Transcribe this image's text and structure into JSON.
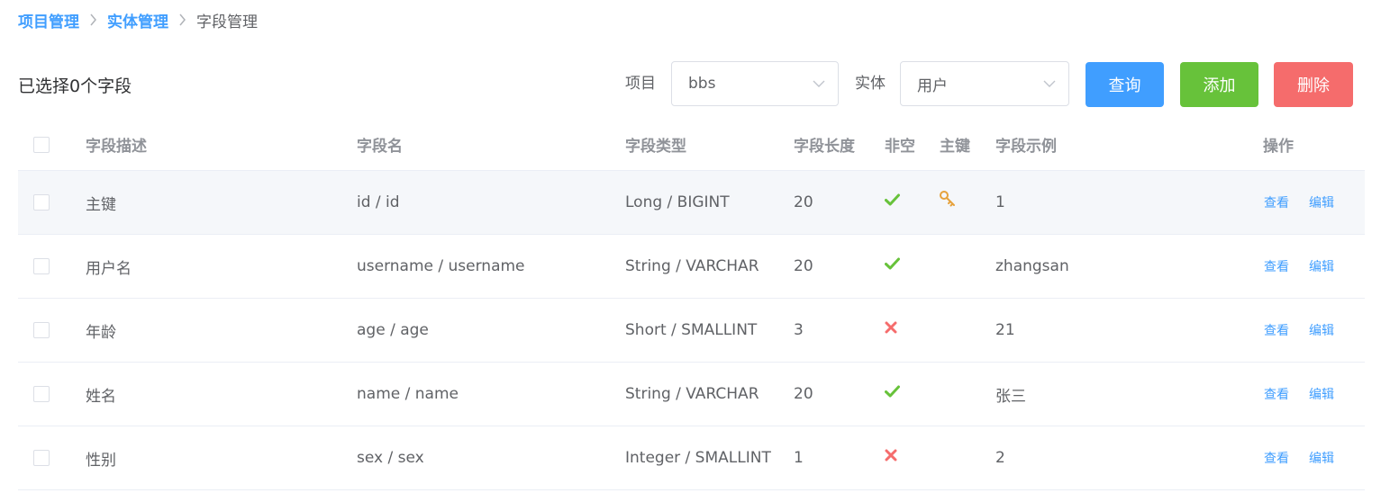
{
  "breadcrumb": {
    "items": [
      "项目管理",
      "实体管理"
    ],
    "current": "字段管理"
  },
  "toolbar": {
    "selected_text": "已选择0个字段",
    "project_label": "项目",
    "project_value": "bbs",
    "entity_label": "实体",
    "entity_value": "用户",
    "query_label": "查询",
    "add_label": "添加",
    "delete_label": "删除"
  },
  "table": {
    "headers": {
      "desc": "字段描述",
      "name": "字段名",
      "type": "字段类型",
      "length": "字段长度",
      "notnull": "非空",
      "pk": "主键",
      "example": "字段示例",
      "actions": "操作"
    },
    "view_label": "查看",
    "edit_label": "编辑",
    "rows": [
      {
        "desc": "主键",
        "name": "id / id",
        "type": "Long / BIGINT",
        "length": "20",
        "notnull": true,
        "pk": true,
        "example": "1"
      },
      {
        "desc": "用户名",
        "name": "username / username",
        "type": "String / VARCHAR",
        "length": "20",
        "notnull": true,
        "pk": false,
        "example": "zhangsan"
      },
      {
        "desc": "年龄",
        "name": "age / age",
        "type": "Short / SMALLINT",
        "length": "3",
        "notnull": false,
        "pk": false,
        "example": "21"
      },
      {
        "desc": "姓名",
        "name": "name / name",
        "type": "String / VARCHAR",
        "length": "20",
        "notnull": true,
        "pk": false,
        "example": "张三"
      },
      {
        "desc": "性别",
        "name": "sex / sex",
        "type": "Integer / SMALLINT",
        "length": "1",
        "notnull": false,
        "pk": false,
        "example": "2"
      }
    ]
  },
  "icons": {
    "breadcrumb_separator": "chevron-right-icon",
    "select_arrow": "chevron-down-icon",
    "not_null_yes": "check-icon",
    "not_null_no": "cross-icon",
    "primary_key": "key-icon"
  },
  "colors": {
    "primary": "#409eff",
    "success": "#67c23a",
    "danger": "#f56c6c",
    "check": "#67c23a",
    "cross": "#f56c6c",
    "key": "#e6a23c",
    "row_highlight": "#f5f7fa"
  }
}
